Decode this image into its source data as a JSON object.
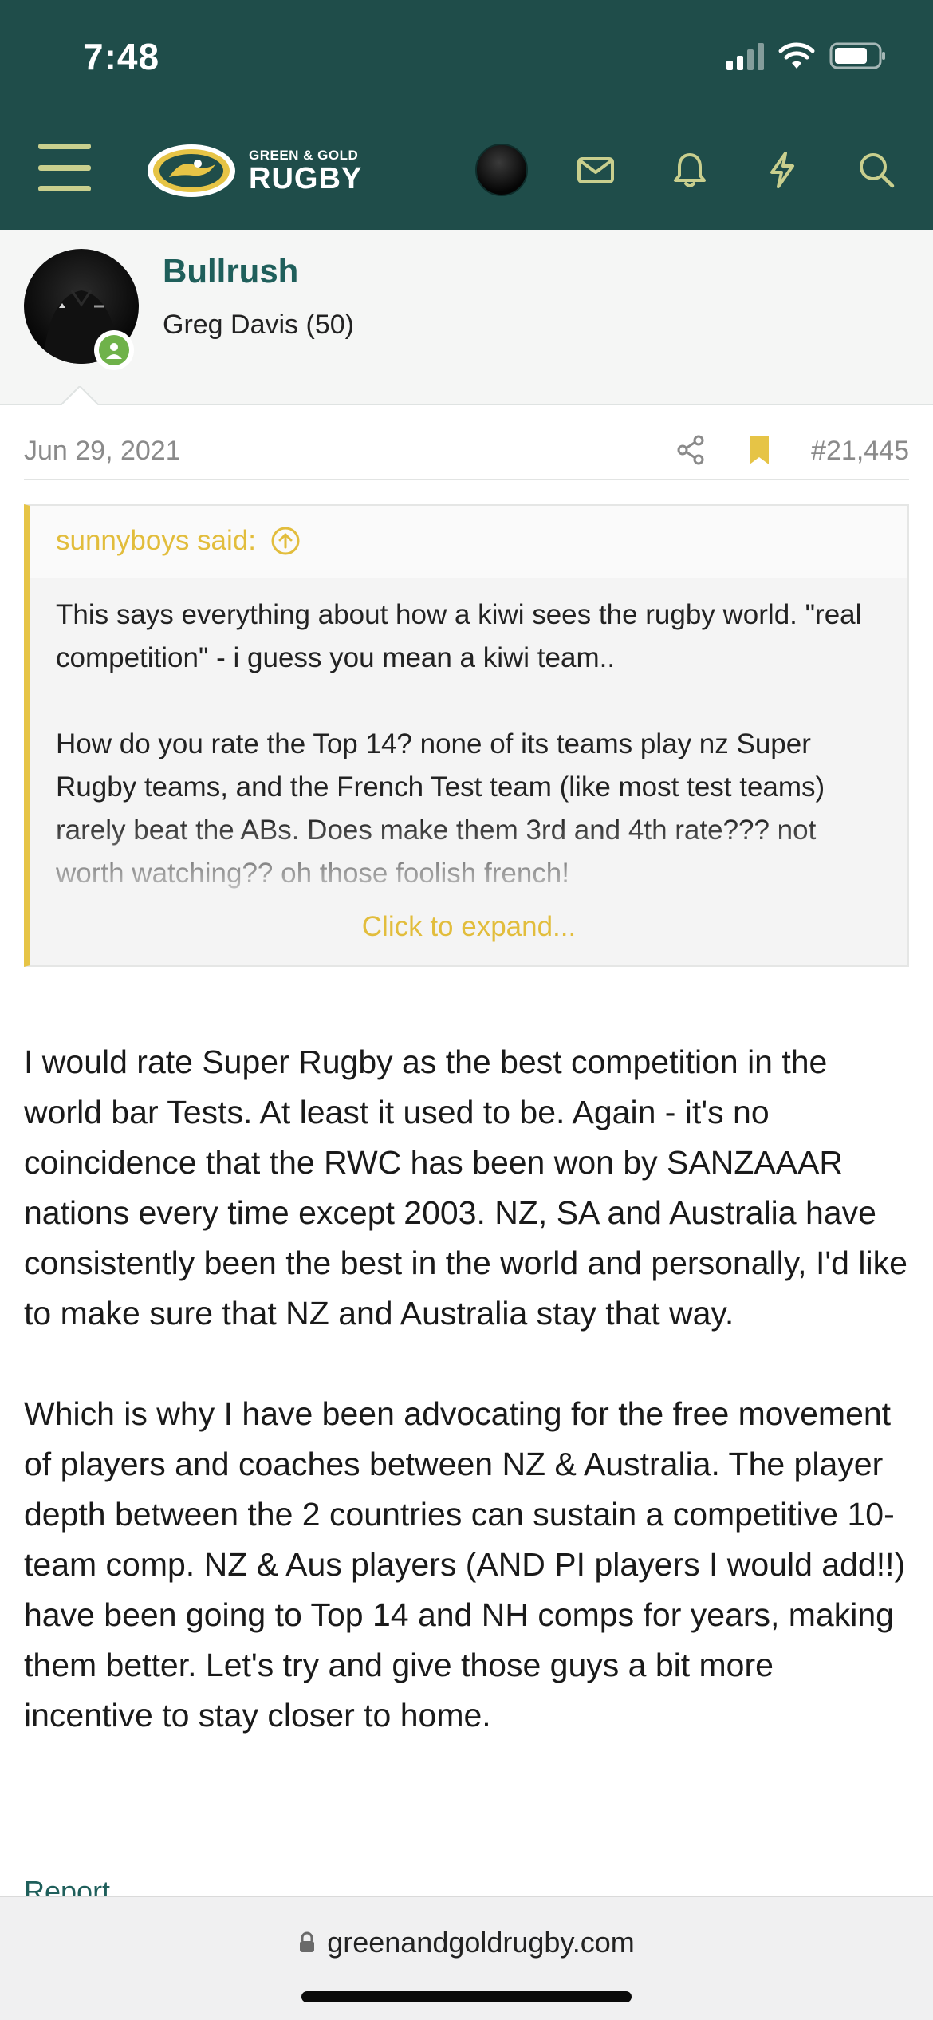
{
  "status_bar": {
    "time": "7:48"
  },
  "nav": {
    "logo_small": "GREEN & GOLD",
    "logo_big": "RUGBY",
    "icons": [
      "menu-icon",
      "avatar",
      "mail-icon",
      "bell-icon",
      "bolt-icon",
      "search-icon"
    ],
    "colors": {
      "header_bg": "#1f4d4a",
      "icon": "#c9cf8e",
      "accent": "#e2bd3c",
      "link": "#1f5f5b"
    }
  },
  "user": {
    "username": "Bullrush",
    "title": "Greg Davis (50)",
    "status": "online"
  },
  "post": {
    "date": "Jun 29, 2021",
    "number": "#21,445",
    "quote": {
      "author": "sunnyboys said:",
      "paragraphs": [
        "This says everything about how a kiwi sees the rugby world. \"real competition\" - i guess you mean a kiwi team..",
        "How do you rate the Top 14? none of its teams play nz Super Rugby teams, and the French Test team (like most test teams) rarely beat the ABs. Does make them 3rd and 4th rate??? not worth watching?? oh those foolish french!"
      ],
      "expand_label": "Click to expand..."
    },
    "body": [
      "I would rate Super Rugby as the best competition in the world bar Tests. At least it used to be. Again - it's no coincidence that the RWC has been won by SANZAAAR nations every time except 2003. NZ, SA and Australia have consistently been the best in the world and personally, I'd like to make sure that NZ and Australia stay that way.",
      "Which is why I have been advocating for the free movement of players and coaches between NZ & Australia. The player depth between the 2 countries can sustain a competitive 10-team comp. NZ & Aus players (AND PI players I would add!!) have been going to Top 14 and NH comps for years, making them better. Let's try and give those guys a bit more incentive to stay closer to home."
    ],
    "report_label": "Report"
  },
  "browser": {
    "url": "greenandgoldrugby.com"
  }
}
